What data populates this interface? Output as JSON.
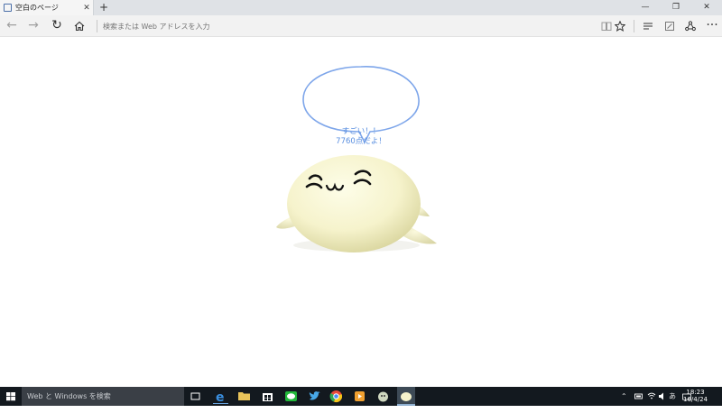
{
  "tab": {
    "title": "空白のページ",
    "close": "✕",
    "new": "+"
  },
  "window": {
    "minimize": "—",
    "maximize": "❐",
    "close": "✕"
  },
  "nav": {
    "back": "←",
    "forward": "→",
    "refresh": "↻",
    "address_placeholder": "検索または Web アドレスを入力"
  },
  "page": {
    "bubble_line1": "すごい！！",
    "bubble_line2": "7760点だよ！"
  },
  "taskbar": {
    "search_placeholder": "Web と Windows を検索",
    "ime": "あ",
    "time": "18:23",
    "date": "16/4/24",
    "apps": [
      "task-view-icon",
      "edge-icon",
      "file-explorer-icon",
      "store-icon",
      "line-icon",
      "twitter-icon",
      "chrome-icon",
      "media-icon",
      "game-icon",
      "seal-app-icon"
    ]
  },
  "colors": {
    "bubble_stroke": "#7ea6ea",
    "bubble_text": "#5a8fe0",
    "seal_body": "#f6f3cc",
    "taskbar": "#13191f"
  }
}
